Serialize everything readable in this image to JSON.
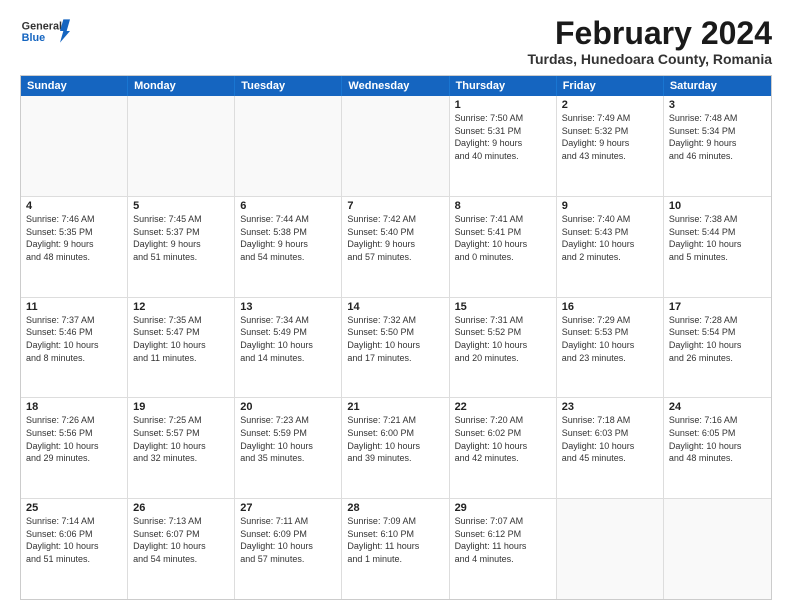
{
  "header": {
    "logo_general": "General",
    "logo_blue": "Blue",
    "main_title": "February 2024",
    "subtitle": "Turdas, Hunedoara County, Romania"
  },
  "calendar": {
    "days": [
      "Sunday",
      "Monday",
      "Tuesday",
      "Wednesday",
      "Thursday",
      "Friday",
      "Saturday"
    ],
    "rows": [
      [
        {
          "num": "",
          "text": "",
          "empty": true
        },
        {
          "num": "",
          "text": "",
          "empty": true
        },
        {
          "num": "",
          "text": "",
          "empty": true
        },
        {
          "num": "",
          "text": "",
          "empty": true
        },
        {
          "num": "1",
          "text": "Sunrise: 7:50 AM\nSunset: 5:31 PM\nDaylight: 9 hours\nand 40 minutes."
        },
        {
          "num": "2",
          "text": "Sunrise: 7:49 AM\nSunset: 5:32 PM\nDaylight: 9 hours\nand 43 minutes."
        },
        {
          "num": "3",
          "text": "Sunrise: 7:48 AM\nSunset: 5:34 PM\nDaylight: 9 hours\nand 46 minutes."
        }
      ],
      [
        {
          "num": "4",
          "text": "Sunrise: 7:46 AM\nSunset: 5:35 PM\nDaylight: 9 hours\nand 48 minutes."
        },
        {
          "num": "5",
          "text": "Sunrise: 7:45 AM\nSunset: 5:37 PM\nDaylight: 9 hours\nand 51 minutes."
        },
        {
          "num": "6",
          "text": "Sunrise: 7:44 AM\nSunset: 5:38 PM\nDaylight: 9 hours\nand 54 minutes."
        },
        {
          "num": "7",
          "text": "Sunrise: 7:42 AM\nSunset: 5:40 PM\nDaylight: 9 hours\nand 57 minutes."
        },
        {
          "num": "8",
          "text": "Sunrise: 7:41 AM\nSunset: 5:41 PM\nDaylight: 10 hours\nand 0 minutes."
        },
        {
          "num": "9",
          "text": "Sunrise: 7:40 AM\nSunset: 5:43 PM\nDaylight: 10 hours\nand 2 minutes."
        },
        {
          "num": "10",
          "text": "Sunrise: 7:38 AM\nSunset: 5:44 PM\nDaylight: 10 hours\nand 5 minutes."
        }
      ],
      [
        {
          "num": "11",
          "text": "Sunrise: 7:37 AM\nSunset: 5:46 PM\nDaylight: 10 hours\nand 8 minutes."
        },
        {
          "num": "12",
          "text": "Sunrise: 7:35 AM\nSunset: 5:47 PM\nDaylight: 10 hours\nand 11 minutes."
        },
        {
          "num": "13",
          "text": "Sunrise: 7:34 AM\nSunset: 5:49 PM\nDaylight: 10 hours\nand 14 minutes."
        },
        {
          "num": "14",
          "text": "Sunrise: 7:32 AM\nSunset: 5:50 PM\nDaylight: 10 hours\nand 17 minutes."
        },
        {
          "num": "15",
          "text": "Sunrise: 7:31 AM\nSunset: 5:52 PM\nDaylight: 10 hours\nand 20 minutes."
        },
        {
          "num": "16",
          "text": "Sunrise: 7:29 AM\nSunset: 5:53 PM\nDaylight: 10 hours\nand 23 minutes."
        },
        {
          "num": "17",
          "text": "Sunrise: 7:28 AM\nSunset: 5:54 PM\nDaylight: 10 hours\nand 26 minutes."
        }
      ],
      [
        {
          "num": "18",
          "text": "Sunrise: 7:26 AM\nSunset: 5:56 PM\nDaylight: 10 hours\nand 29 minutes."
        },
        {
          "num": "19",
          "text": "Sunrise: 7:25 AM\nSunset: 5:57 PM\nDaylight: 10 hours\nand 32 minutes."
        },
        {
          "num": "20",
          "text": "Sunrise: 7:23 AM\nSunset: 5:59 PM\nDaylight: 10 hours\nand 35 minutes."
        },
        {
          "num": "21",
          "text": "Sunrise: 7:21 AM\nSunset: 6:00 PM\nDaylight: 10 hours\nand 39 minutes."
        },
        {
          "num": "22",
          "text": "Sunrise: 7:20 AM\nSunset: 6:02 PM\nDaylight: 10 hours\nand 42 minutes."
        },
        {
          "num": "23",
          "text": "Sunrise: 7:18 AM\nSunset: 6:03 PM\nDaylight: 10 hours\nand 45 minutes."
        },
        {
          "num": "24",
          "text": "Sunrise: 7:16 AM\nSunset: 6:05 PM\nDaylight: 10 hours\nand 48 minutes."
        }
      ],
      [
        {
          "num": "25",
          "text": "Sunrise: 7:14 AM\nSunset: 6:06 PM\nDaylight: 10 hours\nand 51 minutes."
        },
        {
          "num": "26",
          "text": "Sunrise: 7:13 AM\nSunset: 6:07 PM\nDaylight: 10 hours\nand 54 minutes."
        },
        {
          "num": "27",
          "text": "Sunrise: 7:11 AM\nSunset: 6:09 PM\nDaylight: 10 hours\nand 57 minutes."
        },
        {
          "num": "28",
          "text": "Sunrise: 7:09 AM\nSunset: 6:10 PM\nDaylight: 11 hours\nand 1 minute."
        },
        {
          "num": "29",
          "text": "Sunrise: 7:07 AM\nSunset: 6:12 PM\nDaylight: 11 hours\nand 4 minutes."
        },
        {
          "num": "",
          "text": "",
          "empty": true
        },
        {
          "num": "",
          "text": "",
          "empty": true
        }
      ]
    ]
  }
}
